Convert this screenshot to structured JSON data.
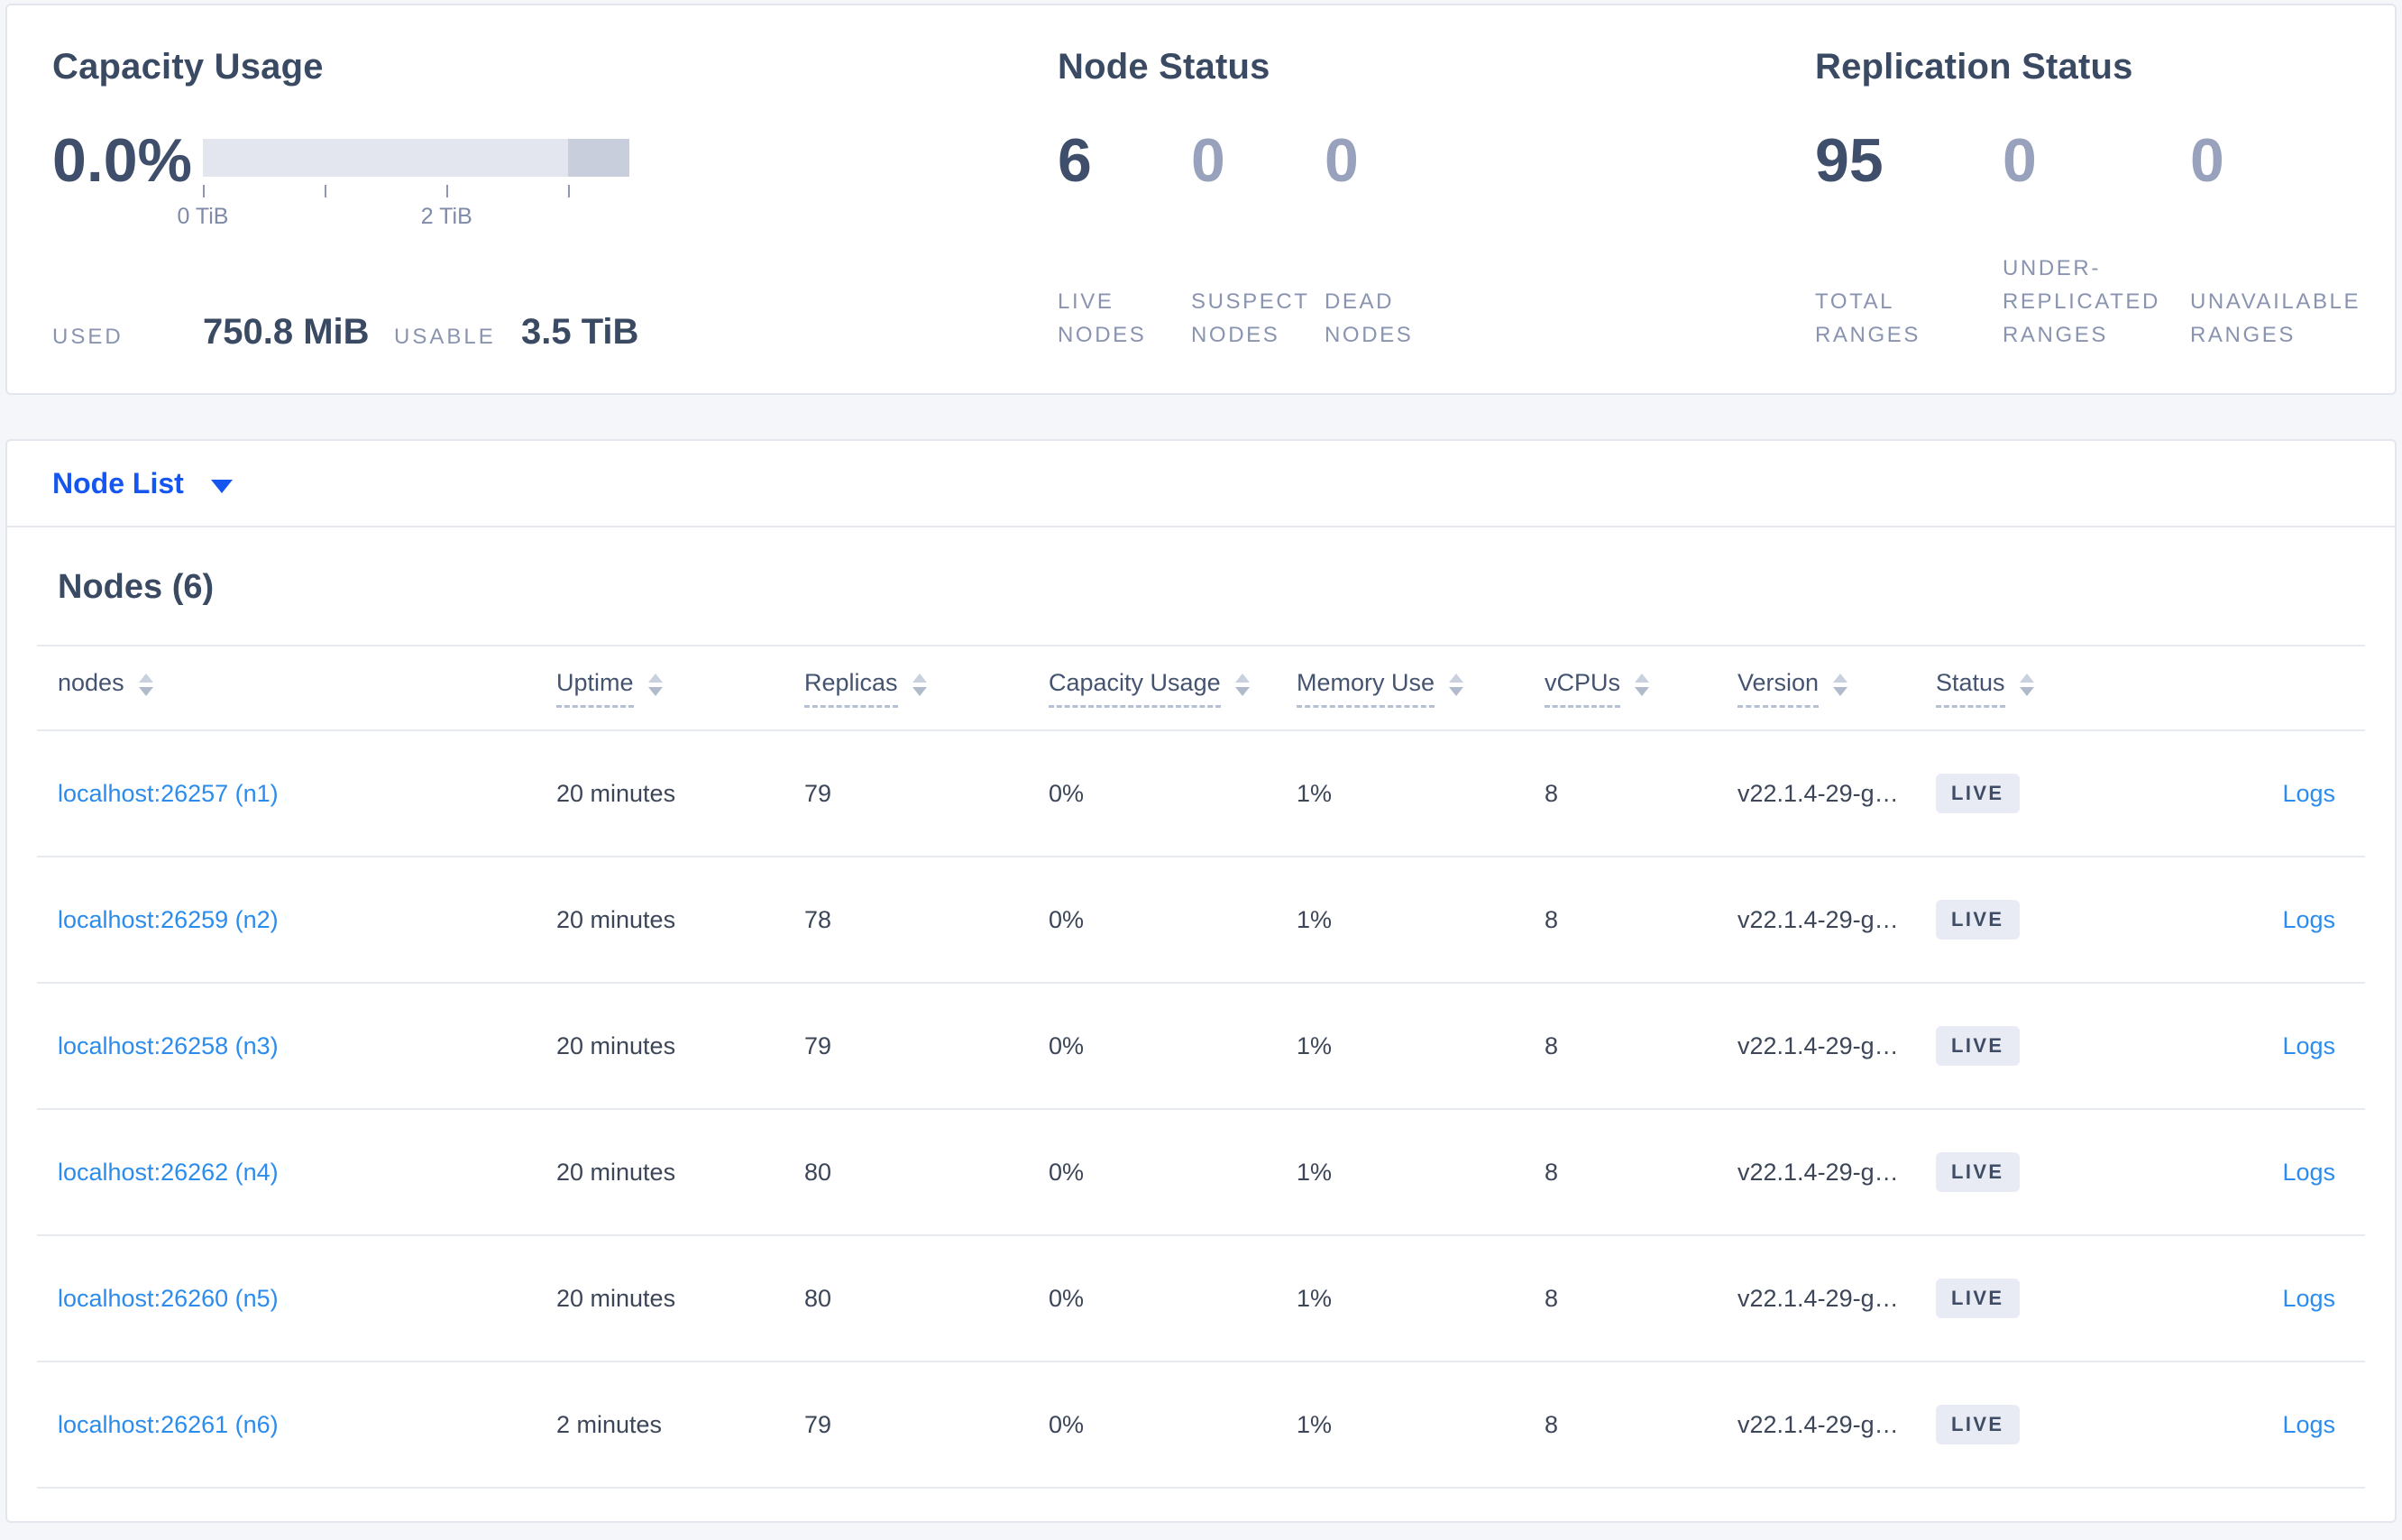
{
  "colors": {
    "page_bg": "#f5f6fa",
    "card_border": "#e3e6ee",
    "heading": "#3b4a63",
    "stat_strong": "#3e4e6b",
    "stat_muted": "#98a2bd",
    "label_gray": "#8a94b0",
    "bar_track": "#e4e6ef",
    "bar_dark": "#c9cedd",
    "tick": "#8d97b2",
    "ticklabel": "#7f8aa8",
    "accent_blue": "#1556f0",
    "link_blue": "#2b8ced",
    "header_text": "#44536f",
    "dash": "#b6c0d4",
    "divider": "#e7eaf0",
    "cell_text": "#3c4658",
    "badge_bg": "#e8ebf3",
    "badge_text": "#3e4c66",
    "sort_up": "#c9d0de",
    "sort_down": "#b0bacb"
  },
  "capacity": {
    "title": "Capacity Usage",
    "percent": "0.0%",
    "used_label": "USED",
    "used_value": "750.8 MiB",
    "usable_label": "USABLE",
    "usable_value": "3.5 TiB",
    "tick_labels": [
      {
        "text": "0 TiB",
        "position_pct": 0
      },
      {
        "text": "2 TiB",
        "position_pct": 57.14
      }
    ]
  },
  "node_status": {
    "title": "Node Status",
    "stats": [
      {
        "value": "6",
        "label": "LIVE NODES",
        "emphasis": true
      },
      {
        "value": "0",
        "label": "SUSPECT NODES"
      },
      {
        "value": "0",
        "label": "DEAD NODES"
      }
    ]
  },
  "replication_status": {
    "title": "Replication Status",
    "stats": [
      {
        "value": "95",
        "label": "TOTAL RANGES",
        "emphasis": true
      },
      {
        "value": "0",
        "label": "UNDER-REPLICATED RANGES"
      },
      {
        "value": "0",
        "label": "UNAVAILABLE RANGES"
      }
    ]
  },
  "node_list": {
    "dropdown_label": "Node List"
  },
  "nodes_table": {
    "title": "Nodes (6)",
    "columns": [
      {
        "label": "nodes",
        "underlined": false
      },
      {
        "label": "Uptime",
        "underlined": true
      },
      {
        "label": "Replicas",
        "underlined": true
      },
      {
        "label": "Capacity Usage",
        "underlined": true
      },
      {
        "label": "Memory Use",
        "underlined": true
      },
      {
        "label": "vCPUs",
        "underlined": true
      },
      {
        "label": "Version",
        "underlined": true
      },
      {
        "label": "Status",
        "underlined": true
      }
    ],
    "rows": [
      {
        "node": "localhost:26257 (n1)",
        "uptime": "20 minutes",
        "replicas": "79",
        "capacity_usage": "0%",
        "memory_use": "1%",
        "vcpus": "8",
        "version": "v22.1.4-29-g…",
        "status": "LIVE",
        "logs_label": "Logs"
      },
      {
        "node": "localhost:26259 (n2)",
        "uptime": "20 minutes",
        "replicas": "78",
        "capacity_usage": "0%",
        "memory_use": "1%",
        "vcpus": "8",
        "version": "v22.1.4-29-g…",
        "status": "LIVE",
        "logs_label": "Logs"
      },
      {
        "node": "localhost:26258 (n3)",
        "uptime": "20 minutes",
        "replicas": "79",
        "capacity_usage": "0%",
        "memory_use": "1%",
        "vcpus": "8",
        "version": "v22.1.4-29-g…",
        "status": "LIVE",
        "logs_label": "Logs"
      },
      {
        "node": "localhost:26262 (n4)",
        "uptime": "20 minutes",
        "replicas": "80",
        "capacity_usage": "0%",
        "memory_use": "1%",
        "vcpus": "8",
        "version": "v22.1.4-29-g…",
        "status": "LIVE",
        "logs_label": "Logs"
      },
      {
        "node": "localhost:26260 (n5)",
        "uptime": "20 minutes",
        "replicas": "80",
        "capacity_usage": "0%",
        "memory_use": "1%",
        "vcpus": "8",
        "version": "v22.1.4-29-g…",
        "status": "LIVE",
        "logs_label": "Logs"
      },
      {
        "node": "localhost:26261 (n6)",
        "uptime": "2 minutes",
        "replicas": "79",
        "capacity_usage": "0%",
        "memory_use": "1%",
        "vcpus": "8",
        "version": "v22.1.4-29-g…",
        "status": "LIVE",
        "logs_label": "Logs"
      }
    ]
  },
  "chart_data": {
    "type": "bar",
    "title": "Capacity Usage",
    "used_percent": 0.0,
    "used": "750.8 MiB",
    "usable": "3.5 TiB",
    "axis_range_tib": [
      0,
      3.5
    ],
    "tick_interval_tib": 1,
    "labeled_ticks": [
      "0 TiB",
      "2 TiB"
    ],
    "reserved_segment_tib": [
      3.0,
      3.5
    ]
  }
}
